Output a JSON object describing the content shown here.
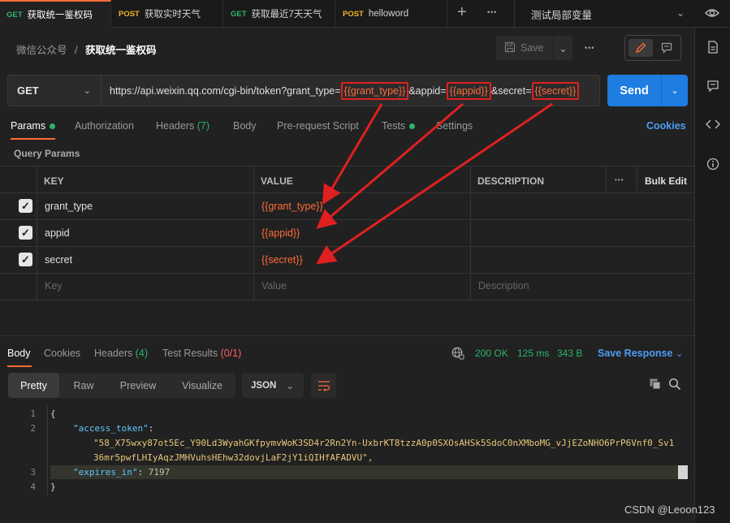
{
  "tabs": [
    {
      "method": "GET",
      "label": "获取统一鉴权码",
      "active": true
    },
    {
      "method": "POST",
      "label": "获取实时天气"
    },
    {
      "method": "GET",
      "label": "获取最近7天天气"
    },
    {
      "method": "POST",
      "label": "helloword"
    }
  ],
  "tabbar": {
    "plus": "+",
    "more": "•••"
  },
  "environment": {
    "name": "测试局部变量"
  },
  "breadcrumb": {
    "collection": "微信公众号",
    "separator": "/",
    "request": "获取统一鉴权码"
  },
  "toolbar": {
    "save": "Save",
    "more": "•••"
  },
  "request": {
    "method": "GET",
    "url_parts": {
      "base": "https://api.weixin.qq.com/cgi-bin/token?grant_type=",
      "v1": "{{grant_type}}",
      "mid1": "&appid=",
      "v2": "{{appid}}",
      "mid2": "&secret=",
      "v3": "{{secret}}"
    },
    "send": "Send"
  },
  "request_tabs": {
    "params": "Params",
    "authorization": "Authorization",
    "headers": "Headers",
    "headers_count": "(7)",
    "body": "Body",
    "prerequest": "Pre-request Script",
    "tests": "Tests",
    "settings": "Settings",
    "cookies": "Cookies"
  },
  "query_params": {
    "title": "Query Params",
    "headers": {
      "key": "KEY",
      "value": "VALUE",
      "description": "DESCRIPTION",
      "more": "•••",
      "bulk": "Bulk Edit"
    },
    "rows": [
      {
        "key": "grant_type",
        "value": "{{grant_type}}",
        "checked": true
      },
      {
        "key": "appid",
        "value": "{{appid}}",
        "checked": true
      },
      {
        "key": "secret",
        "value": "{{secret}}",
        "checked": true
      }
    ],
    "placeholder": {
      "key": "Key",
      "value": "Value",
      "description": "Description"
    }
  },
  "response": {
    "tabs": {
      "body": "Body",
      "cookies": "Cookies",
      "headers": "Headers",
      "headers_count": "(4)",
      "tests": "Test Results",
      "tests_count": "(0/1)"
    },
    "status": "200 OK",
    "time": "125 ms",
    "size": "343 B",
    "save_response": "Save Response",
    "formats": [
      "Pretty",
      "Raw",
      "Preview",
      "Visualize"
    ],
    "language": "JSON",
    "lines": {
      "l1": "{",
      "l2_key": "\"access_token\"",
      "l2_colon": ":",
      "l2_val_a": "\"58_X75wxy87ot5Ec_Y90Ld3WyahGKfpymvWoK3SD4r2Rn2Yn-UxbrKT8tzzA0p0SXOsAHSk5SdoC0nXMboMG_vJjEZoNHO6PrP6Vnf0_Sv1",
      "l2_val_b": "36mr5pwfLHIyAqzJMHVuhsHEhw32dovjLaF2jY1iQIHfAFADVU\",",
      "l3_key": "\"expires_in\"",
      "l3_colon": ": ",
      "l3_val": "7197",
      "l4": "}"
    },
    "line_numbers": [
      "1",
      "2",
      "3",
      "4"
    ]
  },
  "watermark": "CSDN @Leoon123",
  "colors": {
    "accent": "#ff6c37",
    "send": "#1f7ce0",
    "ok": "#2db36b",
    "annotation": "#e02020"
  }
}
